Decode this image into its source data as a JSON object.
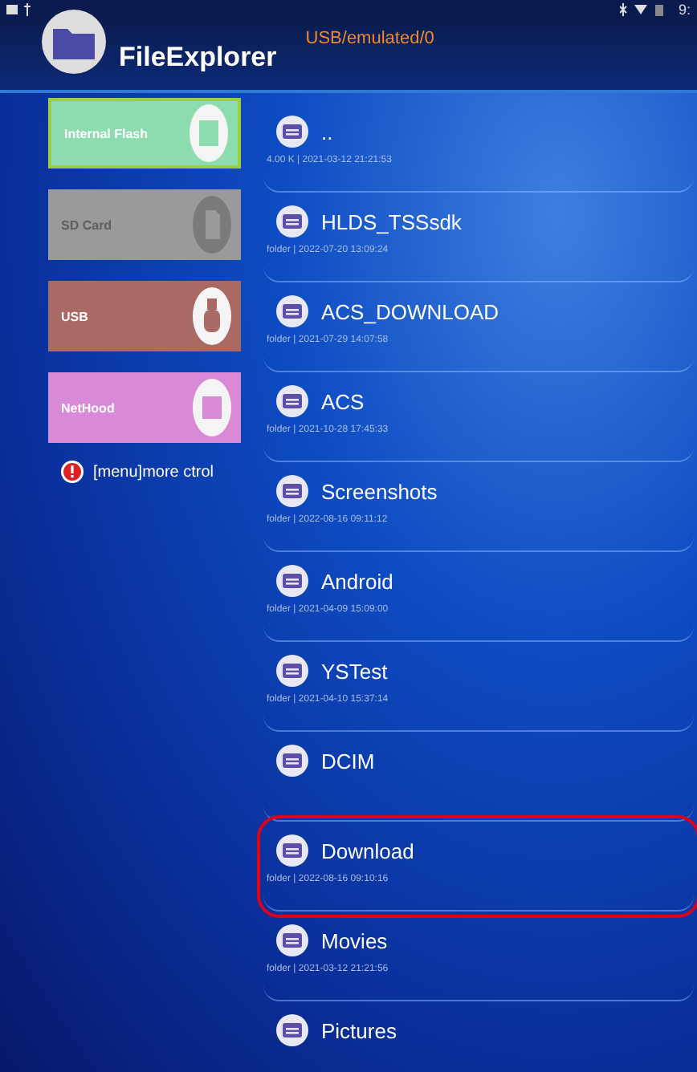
{
  "status_bar": {
    "time": "9:"
  },
  "header": {
    "title": "FileExplorer",
    "path": "USB/emulated/0"
  },
  "storage": [
    {
      "label": "Internal Flash",
      "kind": "chip",
      "color": "#8ddcb0",
      "selected": true,
      "disabled": false
    },
    {
      "label": "SD Card",
      "kind": "sd",
      "color": "#9a9a9a",
      "selected": false,
      "disabled": true
    },
    {
      "label": "USB",
      "kind": "usb",
      "color": "#a86a62",
      "selected": false,
      "disabled": false
    },
    {
      "label": "NetHood",
      "kind": "window",
      "color": "#d98ad6",
      "selected": false,
      "disabled": false
    }
  ],
  "menu_hint": "[menu]more ctrol",
  "files": [
    {
      "name": "..",
      "meta": "4.00 K | 2021-03-12 21:21:53",
      "highlighted": false
    },
    {
      "name": "HLDS_TSSsdk",
      "meta": "folder | 2022-07-20 13:09:24",
      "highlighted": false
    },
    {
      "name": "ACS_DOWNLOAD",
      "meta": "folder | 2021-07-29 14:07:58",
      "highlighted": false
    },
    {
      "name": "ACS",
      "meta": "folder | 2021-10-28 17:45:33",
      "highlighted": false
    },
    {
      "name": "Screenshots",
      "meta": "folder | 2022-08-16 09:11:12",
      "highlighted": false
    },
    {
      "name": "Android",
      "meta": "folder | 2021-04-09 15:09:00",
      "highlighted": false
    },
    {
      "name": "YSTest",
      "meta": "folder | 2021-04-10 15:37:14",
      "highlighted": false
    },
    {
      "name": "DCIM",
      "highlighted": false
    },
    {
      "name": "Download",
      "meta": "folder | 2022-08-16 09:10:16",
      "highlighted": true
    },
    {
      "name": "Movies",
      "meta": "folder | 2021-03-12 21:21:56",
      "highlighted": false
    },
    {
      "name": "Pictures",
      "highlighted": false
    }
  ]
}
